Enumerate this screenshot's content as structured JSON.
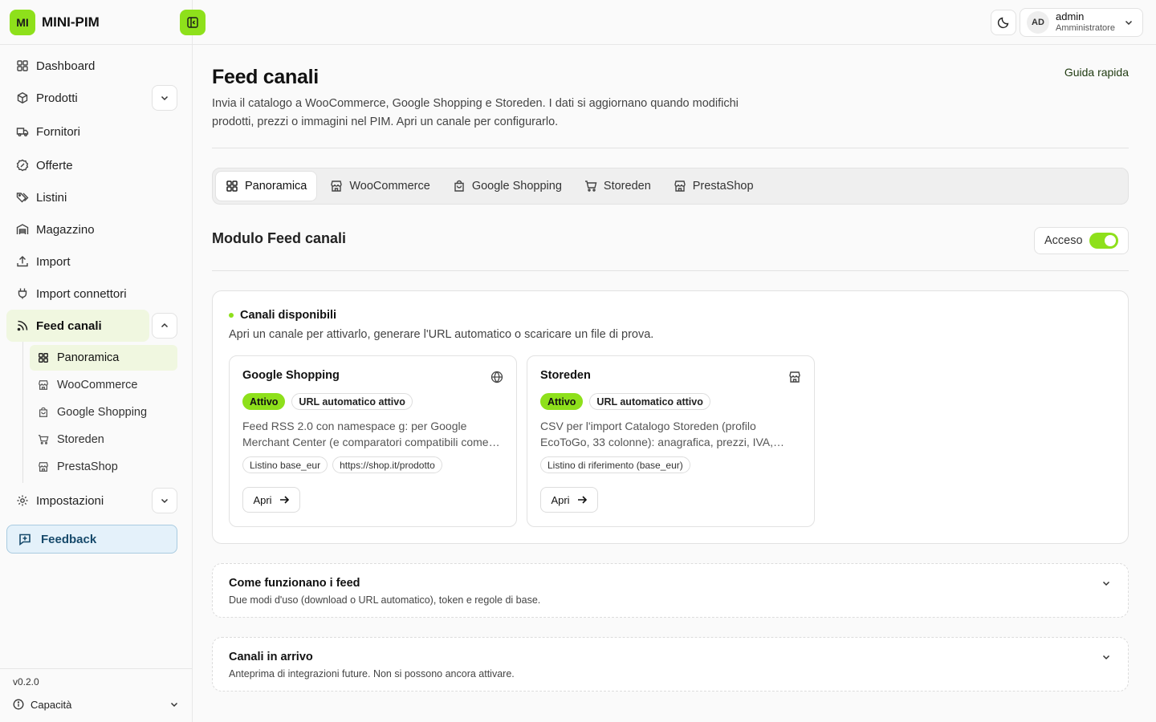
{
  "brand": {
    "badge": "MI",
    "name": "MINI-PIM",
    "accent": "#8ee01b"
  },
  "sidebar": {
    "items": [
      {
        "label": "Dashboard",
        "icon": "dashboard-icon"
      },
      {
        "label": "Prodotti",
        "icon": "box-icon",
        "expandable": true
      },
      {
        "label": "Fornitori",
        "icon": "truck-icon"
      },
      {
        "label": "Offerte",
        "icon": "badge-percent-icon"
      },
      {
        "label": "Listini",
        "icon": "tags-icon"
      },
      {
        "label": "Magazzino",
        "icon": "warehouse-icon"
      },
      {
        "label": "Import",
        "icon": "upload-icon"
      },
      {
        "label": "Import connettori",
        "icon": "plug-icon"
      },
      {
        "label": "Feed canali",
        "icon": "rss-icon",
        "expanded": true,
        "active": true
      }
    ],
    "feed_sub": [
      {
        "label": "Panoramica",
        "icon": "dashboard-icon",
        "active": true
      },
      {
        "label": "WooCommerce",
        "icon": "store-icon"
      },
      {
        "label": "Google Shopping",
        "icon": "shopping-bag-icon"
      },
      {
        "label": "Storeden",
        "icon": "cart-icon"
      },
      {
        "label": "PrestaShop",
        "icon": "store-icon"
      }
    ],
    "settings": "Impostazioni",
    "feedback": "Feedback",
    "version": "v0.2.0",
    "capacity": "Capacità"
  },
  "topbar": {
    "user": {
      "initials": "AD",
      "name": "admin",
      "role": "Amministratore"
    }
  },
  "page": {
    "title": "Feed canali",
    "description": "Invia il catalogo a WooCommerce, Google Shopping e Storeden. I dati si aggiornano quando modifichi prodotti, prezzi o immagini nel PIM. Apri un canale per configurarlo.",
    "guide_link": "Guida rapida"
  },
  "tabs": [
    {
      "label": "Panoramica",
      "icon": "dashboard-icon",
      "active": true
    },
    {
      "label": "WooCommerce",
      "icon": "store-icon"
    },
    {
      "label": "Google Shopping",
      "icon": "shopping-bag-icon"
    },
    {
      "label": "Storeden",
      "icon": "cart-icon"
    },
    {
      "label": "PrestaShop",
      "icon": "store-icon"
    }
  ],
  "module": {
    "title": "Modulo Feed canali",
    "access_label": "Acceso",
    "enabled": true
  },
  "channels_card": {
    "title": "Canali disponibili",
    "subtitle": "Apri un canale per attivarlo, generare l'URL automatico o scaricare un file di prova.",
    "channels": [
      {
        "name": "Google Shopping",
        "icon": "globe-icon",
        "status": "Attivo",
        "url_status": "URL automatico attivo",
        "description": "Feed RSS 2.0 con namespace g: per Google Merchant Center (e comparatori compatibili come Idealo, Trovaprezzi).",
        "chips": [
          "Listino base_eur",
          "https://shop.it/prodotto"
        ],
        "open_label": "Apri"
      },
      {
        "name": "Storeden",
        "icon": "store-icon",
        "status": "Attivo",
        "url_status": "URL automatico attivo",
        "description": "CSV per l'import Catalogo Storeden (profilo EcoToGo, 33 colonne): anagrafica, prezzi, IVA, immagini e varianti.",
        "chips": [
          "Listino di riferimento (base_eur)"
        ],
        "open_label": "Apri"
      }
    ]
  },
  "accordions": [
    {
      "title": "Come funzionano i feed",
      "subtitle": "Due modi d'uso (download o URL automatico), token e regole di base."
    },
    {
      "title": "Canali in arrivo",
      "subtitle": "Anteprima di integrazioni future. Non si possono ancora attivare."
    }
  ]
}
